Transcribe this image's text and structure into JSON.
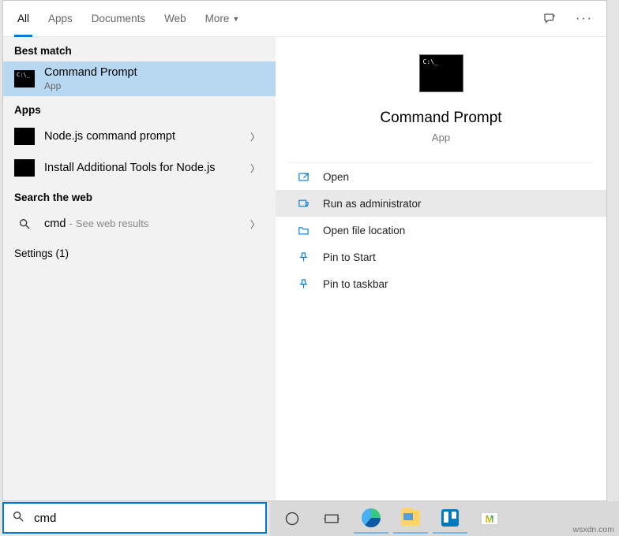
{
  "tabs": {
    "all": "All",
    "apps": "Apps",
    "documents": "Documents",
    "web": "Web",
    "more": "More"
  },
  "sections": {
    "best_match": "Best match",
    "apps": "Apps",
    "search_web": "Search the web",
    "settings": "Settings (1)"
  },
  "best_match": {
    "title": "Command Prompt",
    "sub": "App"
  },
  "apps_results": {
    "0": {
      "title": "Node.js command prompt"
    },
    "1": {
      "title": "Install Additional Tools for Node.js"
    }
  },
  "web_result": {
    "query": "cmd",
    "suffix": "See web results"
  },
  "preview": {
    "title": "Command Prompt",
    "sub": "App"
  },
  "actions": {
    "open": "Open",
    "run_admin": "Run as administrator",
    "open_loc": "Open file location",
    "pin_start": "Pin to Start",
    "pin_taskbar": "Pin to taskbar"
  },
  "search": {
    "value": "cmd"
  },
  "watermark": "wsxdn.com"
}
